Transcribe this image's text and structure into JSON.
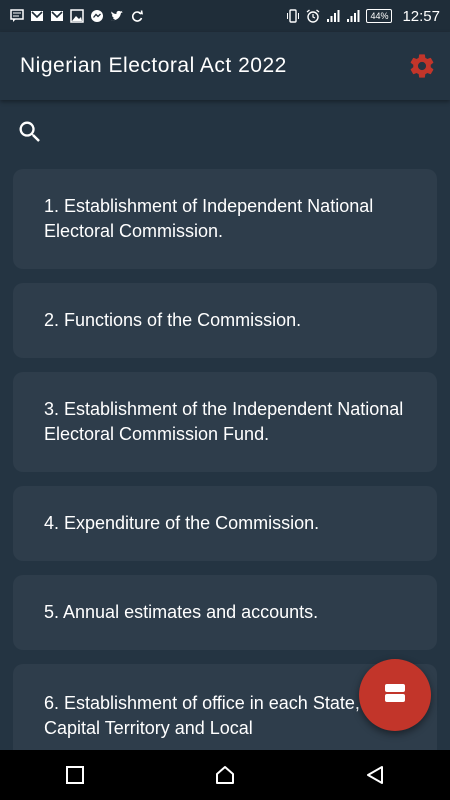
{
  "status_bar": {
    "time": "12:57",
    "battery": "44%",
    "left_icons": [
      "message-icon",
      "gmail-icon",
      "gmail-icon",
      "image-icon",
      "messenger-icon",
      "twitter-icon",
      "sync-icon"
    ],
    "right_icons": [
      "vibrate-icon",
      "alarm-icon",
      "signal-icon",
      "signal-icon",
      "battery-icon"
    ]
  },
  "app_bar": {
    "title": "Nigerian Electoral Act 2022",
    "settings_icon": "gear-icon",
    "accent_color": "#c2352a"
  },
  "search": {
    "icon": "search-icon"
  },
  "sections": [
    {
      "label": "1. Establishment of Independent National Electoral Commission."
    },
    {
      "label": "2. Functions of the Commission."
    },
    {
      "label": "3. Establishment of the Independent National Electoral Commission Fund."
    },
    {
      "label": "4. Expenditure of the Commission."
    },
    {
      "label": "5. Annual estimates and accounts."
    },
    {
      "label": "6. Establishment of office in each State, Federal Capital Territory and Local"
    }
  ],
  "fab": {
    "icon": "view-agenda-icon",
    "color": "#c2352a"
  },
  "nav_bar": {
    "icons": [
      "recents-icon",
      "home-icon",
      "back-icon"
    ]
  }
}
